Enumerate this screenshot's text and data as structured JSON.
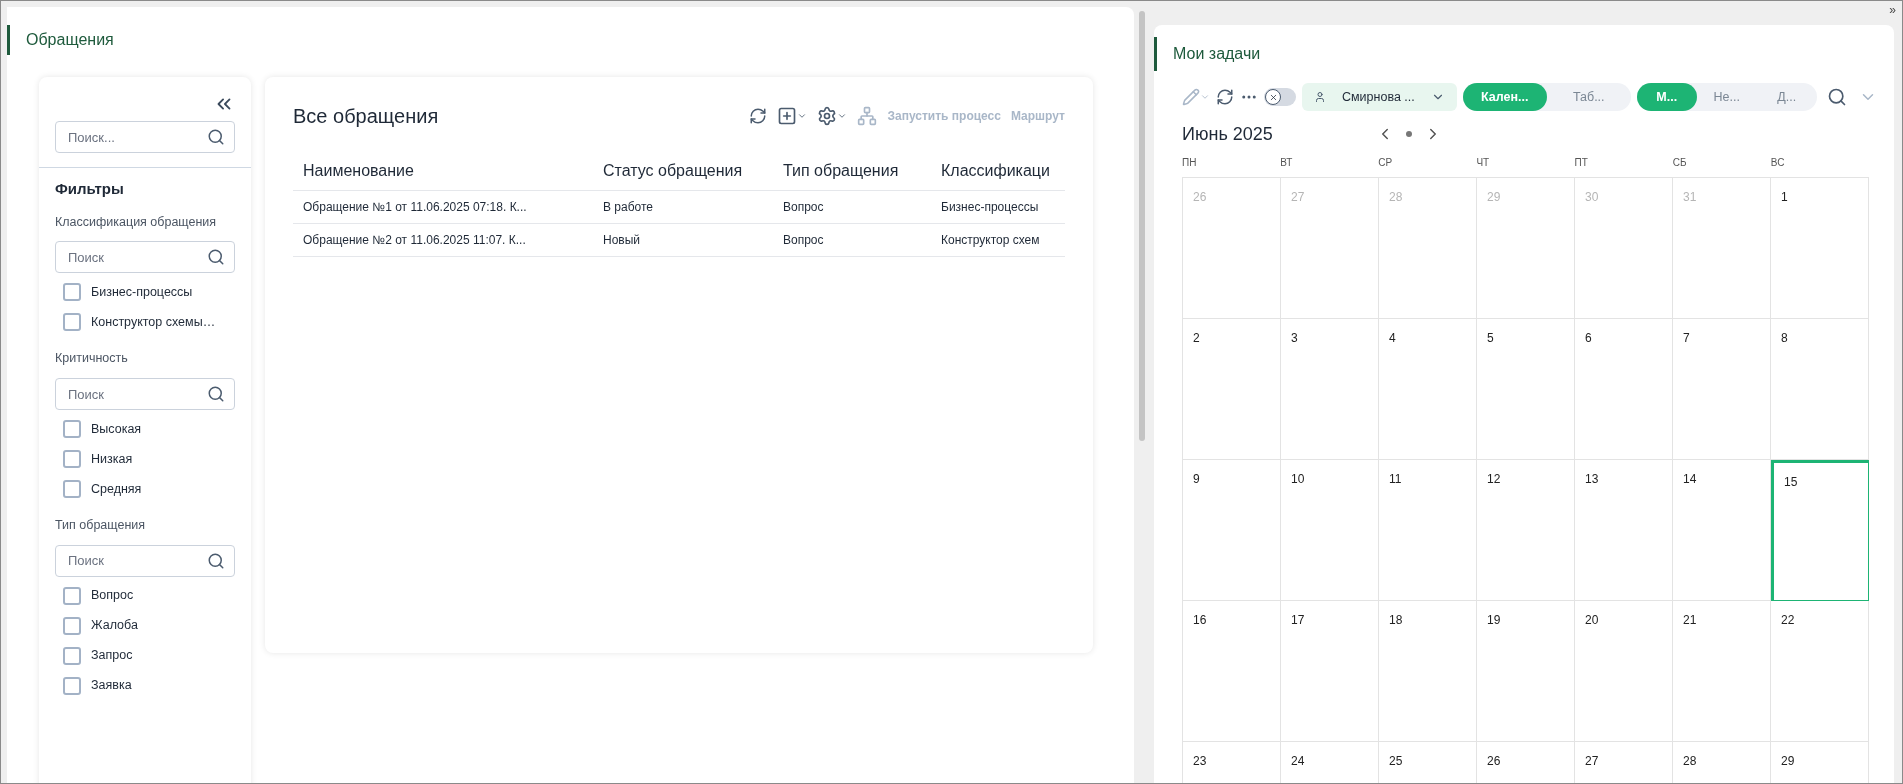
{
  "expand_glyph": "»",
  "appeals": {
    "title": "Обращения",
    "filters": {
      "search_placeholder": "Поиск...",
      "heading": "Фильтры",
      "groups": [
        {
          "title": "Классификация обращения",
          "placeholder": "Поиск",
          "items": [
            {
              "label": "Бизнес-процессы",
              "checked": false
            },
            {
              "label": "Конструктор схемы…",
              "checked": false
            }
          ]
        },
        {
          "title": "Критичность",
          "placeholder": "Поиск",
          "items": [
            {
              "label": "Высокая",
              "checked": false
            },
            {
              "label": "Низкая",
              "checked": false
            },
            {
              "label": "Средняя",
              "checked": false
            }
          ]
        },
        {
          "title": "Тип обращения",
          "placeholder": "Поиск",
          "items": [
            {
              "label": "Вопрос",
              "checked": false
            },
            {
              "label": "Жалоба",
              "checked": false
            },
            {
              "label": "Запрос",
              "checked": false
            },
            {
              "label": "Заявка",
              "checked": false
            }
          ]
        }
      ]
    },
    "table": {
      "title": "Все обращения",
      "actions": [
        {
          "label": "Запустить процесс",
          "disabled": true
        },
        {
          "label": "Маршрут",
          "disabled": true
        }
      ],
      "columns": [
        "Наименование",
        "Статус обращения",
        "Тип обращения",
        "Классификаци"
      ],
      "rows": [
        [
          "Обращение №1 от 11.06.2025 07:18. К...",
          "В работе",
          "Вопрос",
          "Бизнес-процессы"
        ],
        [
          "Обращение №2 от 11.06.2025 11:07. К...",
          "Новый",
          "Вопрос",
          "Конструктор схем"
        ]
      ]
    }
  },
  "tasks": {
    "title": "Мои задачи",
    "switch_on": false,
    "user": "Смирнова ...",
    "views": [
      {
        "label": "Кален...",
        "selected": true
      },
      {
        "label": "Таб...",
        "selected": false
      }
    ],
    "periods": [
      {
        "label": "М...",
        "selected": true
      },
      {
        "label": "Не...",
        "selected": false
      },
      {
        "label": "Д...",
        "selected": false
      }
    ],
    "month": "Июнь 2025",
    "weekdays": [
      "ПН",
      "ВТ",
      "СР",
      "ЧТ",
      "ПТ",
      "СБ",
      "ВС"
    ],
    "weeks": [
      [
        {
          "day": "26",
          "muted": true,
          "selected": false
        },
        {
          "day": "27",
          "muted": true,
          "selected": false
        },
        {
          "day": "28",
          "muted": true,
          "selected": false
        },
        {
          "day": "29",
          "muted": true,
          "selected": false
        },
        {
          "day": "30",
          "muted": true,
          "selected": false
        },
        {
          "day": "31",
          "muted": true,
          "selected": false
        },
        {
          "day": "1",
          "muted": false,
          "selected": false
        }
      ],
      [
        {
          "day": "2",
          "muted": false,
          "selected": false
        },
        {
          "day": "3",
          "muted": false,
          "selected": false
        },
        {
          "day": "4",
          "muted": false,
          "selected": false
        },
        {
          "day": "5",
          "muted": false,
          "selected": false
        },
        {
          "day": "6",
          "muted": false,
          "selected": false
        },
        {
          "day": "7",
          "muted": false,
          "selected": false
        },
        {
          "day": "8",
          "muted": false,
          "selected": false
        }
      ],
      [
        {
          "day": "9",
          "muted": false,
          "selected": false
        },
        {
          "day": "10",
          "muted": false,
          "selected": false
        },
        {
          "day": "11",
          "muted": false,
          "selected": false
        },
        {
          "day": "12",
          "muted": false,
          "selected": false
        },
        {
          "day": "13",
          "muted": false,
          "selected": false
        },
        {
          "day": "14",
          "muted": false,
          "selected": false
        },
        {
          "day": "15",
          "muted": false,
          "selected": true
        }
      ],
      [
        {
          "day": "16",
          "muted": false,
          "selected": false
        },
        {
          "day": "17",
          "muted": false,
          "selected": false
        },
        {
          "day": "18",
          "muted": false,
          "selected": false
        },
        {
          "day": "19",
          "muted": false,
          "selected": false
        },
        {
          "day": "20",
          "muted": false,
          "selected": false
        },
        {
          "day": "21",
          "muted": false,
          "selected": false
        },
        {
          "day": "22",
          "muted": false,
          "selected": false
        }
      ],
      [
        {
          "day": "23",
          "muted": false,
          "selected": false
        },
        {
          "day": "24",
          "muted": false,
          "selected": false
        },
        {
          "day": "25",
          "muted": false,
          "selected": false
        },
        {
          "day": "26",
          "muted": false,
          "selected": false
        },
        {
          "day": "27",
          "muted": false,
          "selected": false
        },
        {
          "day": "28",
          "muted": false,
          "selected": false
        },
        {
          "day": "29",
          "muted": false,
          "selected": false
        }
      ]
    ]
  }
}
